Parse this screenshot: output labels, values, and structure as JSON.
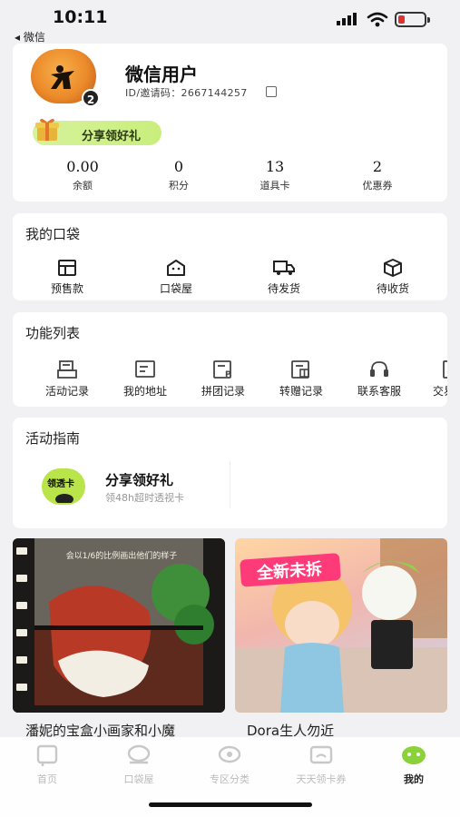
{
  "status": {
    "time": "10:11",
    "back_label": "◂ 微信",
    "battery_color": "#e03131"
  },
  "profile": {
    "username": "微信用户",
    "id_line": "ID/邀请码：2667144257",
    "level": "2",
    "gift_label": "分享领好礼"
  },
  "stats": [
    {
      "value": "0.00",
      "label": "余额"
    },
    {
      "value": "0",
      "label": "积分"
    },
    {
      "value": "13",
      "label": "道具卡"
    },
    {
      "value": "2",
      "label": "优惠券"
    }
  ],
  "pocket": {
    "title": "我的口袋",
    "items": [
      {
        "label": "预售款",
        "icon": "presale-icon"
      },
      {
        "label": "口袋屋",
        "icon": "pocket-house-icon"
      },
      {
        "label": "待发货",
        "icon": "truck-icon"
      },
      {
        "label": "待收货",
        "icon": "package-icon"
      }
    ]
  },
  "functions": {
    "title": "功能列表",
    "items": [
      {
        "label": "活动记录",
        "icon": "activity-record-icon"
      },
      {
        "label": "我的地址",
        "icon": "address-icon"
      },
      {
        "label": "拼团记录",
        "icon": "group-buy-icon"
      },
      {
        "label": "转赠记录",
        "icon": "gift-transfer-icon"
      },
      {
        "label": "联系客服",
        "icon": "headset-icon"
      },
      {
        "label": "交易",
        "icon": "trade-icon"
      }
    ]
  },
  "guide": {
    "title": "活动指南",
    "card_badge": "领透卡",
    "card_title": "分享领好礼",
    "card_subtitle": "领48h超时透视卡"
  },
  "products": [
    {
      "title": "潘妮的宝盒小画家和小魔",
      "caption": "会以1/6的比例画出他们的样子"
    },
    {
      "title": "Dora生人勿近",
      "badge": "全新未拆"
    }
  ],
  "tabs": [
    {
      "label": "首页",
      "icon": "home-tab-icon"
    },
    {
      "label": "口袋屋",
      "icon": "pocket-tab-icon"
    },
    {
      "label": "专区分类",
      "icon": "category-tab-icon"
    },
    {
      "label": "天天领卡券",
      "icon": "coupon-tab-icon"
    },
    {
      "label": "我的",
      "icon": "mine-tab-icon"
    }
  ]
}
